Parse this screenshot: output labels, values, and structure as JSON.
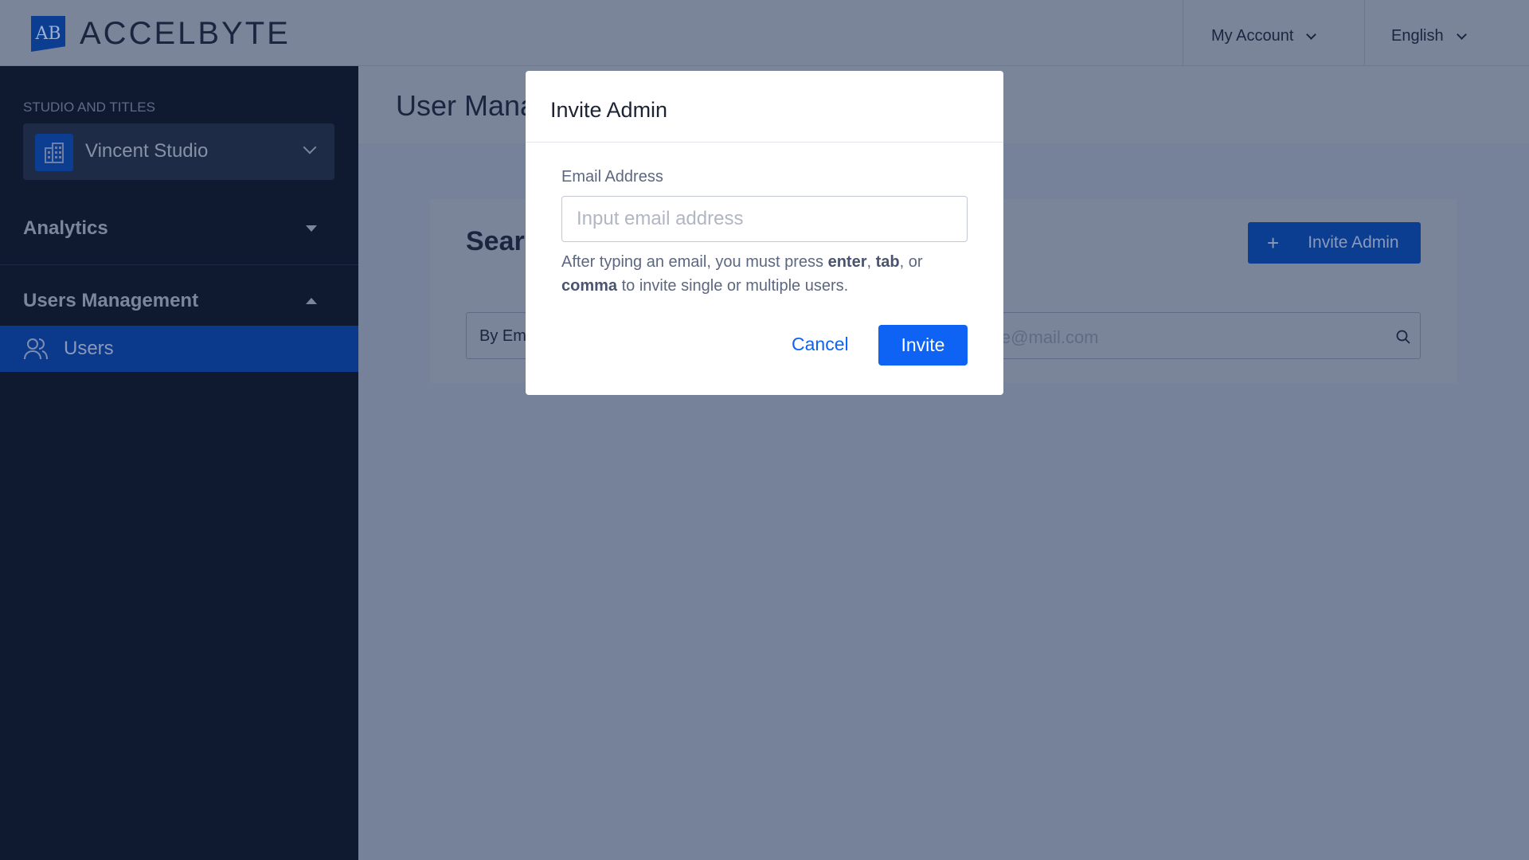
{
  "header": {
    "logo_text": "ACCELBYTE",
    "logo_mark": "AB",
    "my_account": "My Account",
    "language": "English"
  },
  "sidebar": {
    "section_label": "STUDIO AND TITLES",
    "studio": "Vincent Studio",
    "analytics": "Analytics",
    "users_management": "Users Management",
    "items": [
      {
        "label": "Users",
        "icon": "users-icon",
        "active": true
      }
    ]
  },
  "main": {
    "title": "User Management",
    "search_title": "Search",
    "invite_admin_label": "Invite Admin",
    "search_by": "By Email",
    "search_placeholder": "example@mail.com"
  },
  "modal": {
    "title": "Invite Admin",
    "email_label": "Email Address",
    "email_placeholder": "Input email address",
    "email_value": "",
    "help_pre": "After typing an email, you must press ",
    "help_enter": "enter",
    "help_sep1": ", ",
    "help_tab": "tab",
    "help_sep2": ", or ",
    "help_comma": "comma",
    "help_post": " to invite single or multiple users.",
    "cancel": "Cancel",
    "invite": "Invite"
  },
  "colors": {
    "primary": "#0e63f4",
    "sidebar": "#0f1a31",
    "overlay_bg": "#76819a"
  }
}
